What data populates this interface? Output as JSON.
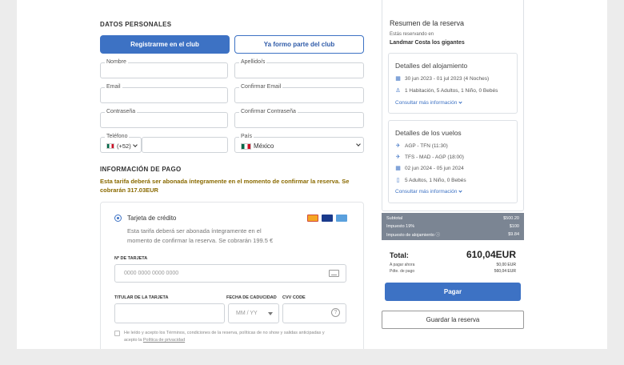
{
  "personal": {
    "section_title": "DATOS PERSONALES",
    "register_button": "Registrarme en el club",
    "member_button": "Ya formo parte del club",
    "name_label": "Nombre",
    "surname_label": "Apellido/s",
    "email_label": "Email",
    "confirm_email_label": "Confirmar Email",
    "password_label": "Contraseña",
    "confirm_password_label": "Confirmar Contraseña",
    "phone_label": "Teléfono",
    "phone_prefix": "(+52)",
    "country_label": "País",
    "country_value": "México"
  },
  "payment": {
    "section_title": "INFORMACIÓN DE PAGO",
    "warning": "Esta tarifa deberá ser abonada íntegramente en el momento de confirmar la reserva. Se cobrarán 317.03EUR",
    "method_label": "Tarjeta de crédito",
    "method_note": "Esta tarifa deberá ser abonada íntegramente en el momento de confirmar la reserva. Se cobrarán 199.5 €",
    "card_number_label": "Nº DE TARJETA",
    "card_number_placeholder": "0000 0000 0000 0000",
    "holder_label": "TITULAR DE LA TARJETA",
    "expiry_label": "FECHA DE CADUCIDAD",
    "expiry_placeholder": "MM / YY",
    "cvv_label": "CVV CODE",
    "terms_text": "He leído y acepto los Términos, condiciones de la reserva, políticas de no show y salidas anticipadas y acepto la",
    "privacy_link": "Política de privacidad",
    "card_brands": [
      "mastercard",
      "visa",
      "amex"
    ]
  },
  "summary": {
    "title": "Resumen de la reserva",
    "booking_at": "Estás reservando en",
    "hotel": "Landmar Costa los gigantes",
    "lodging": {
      "title": "Detalles del alojamiento",
      "dates": "30 jun 2023 - 01 jul 2023 (4 Noches)",
      "rooms": "1 Habitación, 5 Adultos, 1 Niño, 0 Bebés",
      "more": "Consultar más información"
    },
    "flights": {
      "title": "Detalles de los vuelos",
      "leg1": "AGP - TFN (11:30)",
      "leg2": "TFS - MAD - AGP (18:00)",
      "dates": "02 jun 2024 - 05 jun 2024",
      "pax": "5 Adultos, 1 Niño, 0 Bebés",
      "more": "Consultar más información"
    },
    "breakdown": [
      {
        "label": "Subtotal",
        "value": "$500.20"
      },
      {
        "label": "Impuesto 19%",
        "value": "$100"
      },
      {
        "label": "Impuesto de alojamiento",
        "value": "$9.84"
      }
    ],
    "total_label": "Total:",
    "total_value": "610,04EUR",
    "pay_now_label": "A pagar ahora",
    "pay_now_value": "50,00 EUR",
    "pending_label": "Pdte. de pago",
    "pending_value": "560,04 EUR",
    "pay_button": "Pagar",
    "save_button": "Guardar la reserva"
  },
  "colors": {
    "accent": "#3d72c4",
    "warning": "#8a6a00",
    "totals_bar": "#7b8593"
  }
}
